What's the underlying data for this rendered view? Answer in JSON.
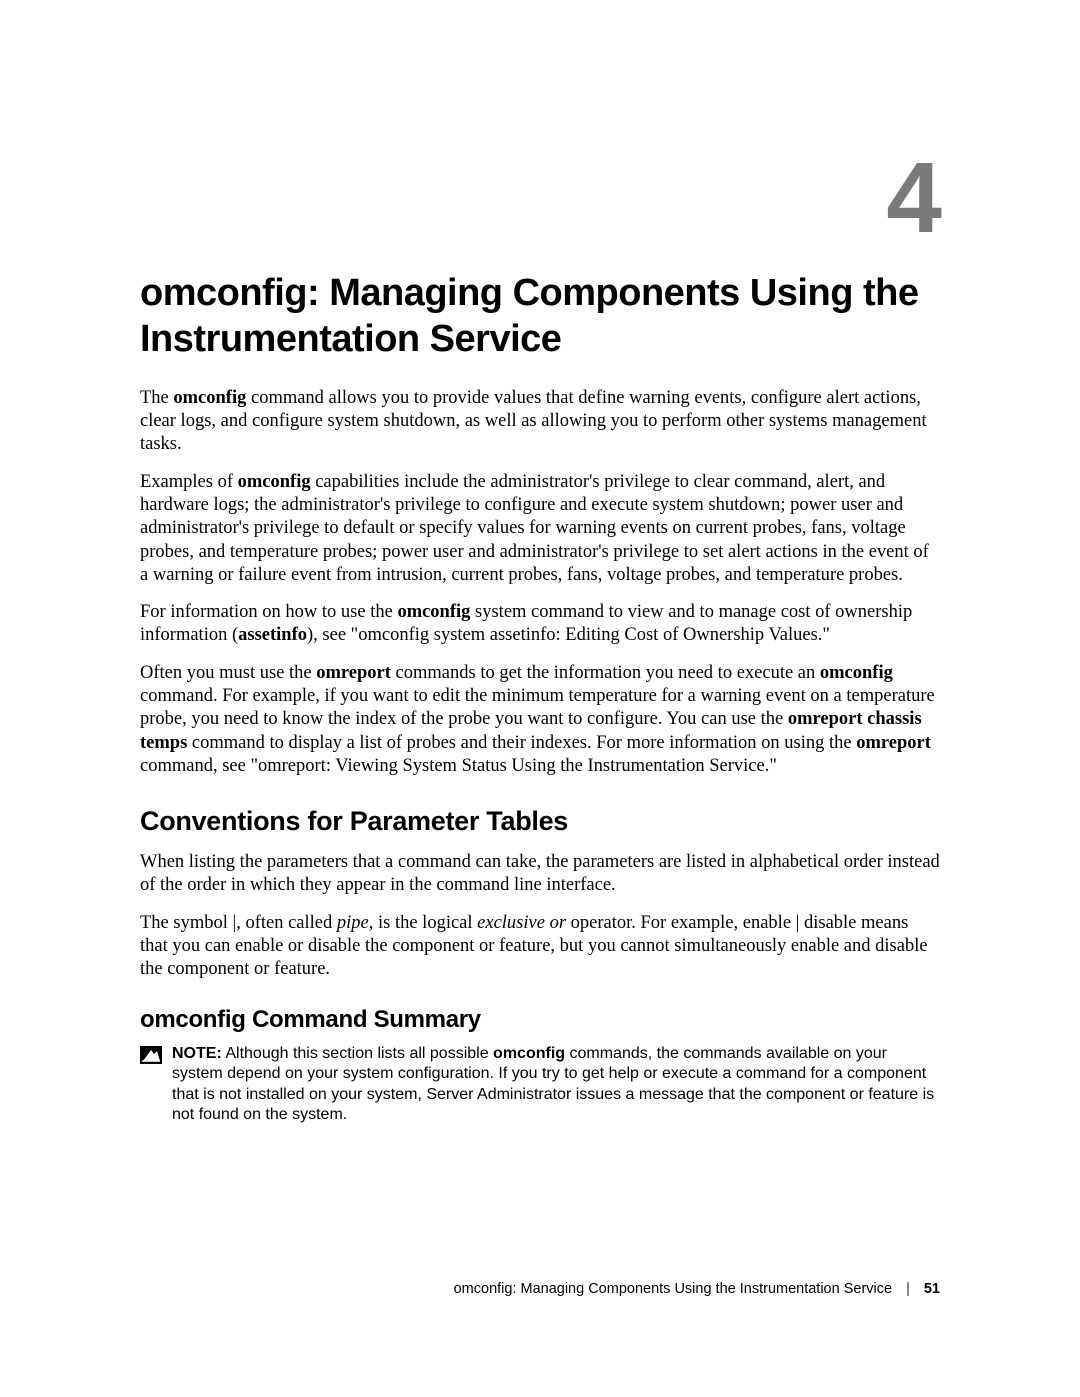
{
  "chapter": {
    "number": "4",
    "title": "omconfig: Managing Components Using the Instrumentation Service"
  },
  "paragraphs": {
    "p1_a": "The ",
    "p1_b": "omconfig",
    "p1_c": " command allows you to provide values that define warning events, configure alert actions, clear logs, and configure system shutdown, as well as allowing you to perform other systems management tasks.",
    "p2_a": "Examples of ",
    "p2_b": "omconfig",
    "p2_c": " capabilities include the administrator's privilege to clear command, alert, and hardware logs; the administrator's privilege to configure and execute system shutdown; power user and administrator's privilege to default or specify values for warning events on current probes, fans, voltage probes, and temperature probes; power user and administrator's privilege to set alert actions in the event of a warning or failure event from intrusion, current probes, fans, voltage probes, and temperature probes.",
    "p3_a": "For information on how to use the ",
    "p3_b": "omconfig",
    "p3_c": " system command to view and to manage cost of ownership information (",
    "p3_d": "assetinfo",
    "p3_e": "), see \"omconfig system assetinfo: Editing Cost of Ownership Values.\"",
    "p4_a": "Often you must use the ",
    "p4_b": "omreport",
    "p4_c": " commands to get the information you need to execute an ",
    "p4_d": "omconfig",
    "p4_e": " command. For example, if you want to edit the minimum temperature for a warning event on a temperature probe, you need to know the index of the probe you want to configure. You can use the ",
    "p4_f": "omreport chassis temps",
    "p4_g": " command to display a list of probes and their indexes. For more information on using the ",
    "p4_h": "omreport",
    "p4_i": " command, see \"omreport: Viewing System Status Using the Instrumentation Service.\""
  },
  "sections": {
    "conventions_heading": "Conventions for Parameter Tables",
    "conventions_p1": "When listing the parameters that a command can take, the parameters are listed in alphabetical order instead of the order in which they appear in the command line interface.",
    "conventions_p2_a": "The symbol |, often called ",
    "conventions_p2_b": "pipe",
    "conventions_p2_c": ", is the logical ",
    "conventions_p2_d": "exclusive or",
    "conventions_p2_e": " operator. For example, enable | disable means that you can enable or disable the component or feature, but you cannot simultaneously enable and disable the component or feature.",
    "summary_heading": "omconfig Command Summary"
  },
  "note": {
    "label": "NOTE:",
    "text_a": " Although this section lists all possible ",
    "text_b": "omconfig",
    "text_c": " commands, the commands available on your system depend on your system configuration. If you try to get help or execute a command for a component that is not installed on your system, Server Administrator issues a message that the component or feature is not found on the system."
  },
  "footer": {
    "title": "omconfig: Managing Components Using the Instrumentation Service",
    "separator": "|",
    "page": "51"
  }
}
